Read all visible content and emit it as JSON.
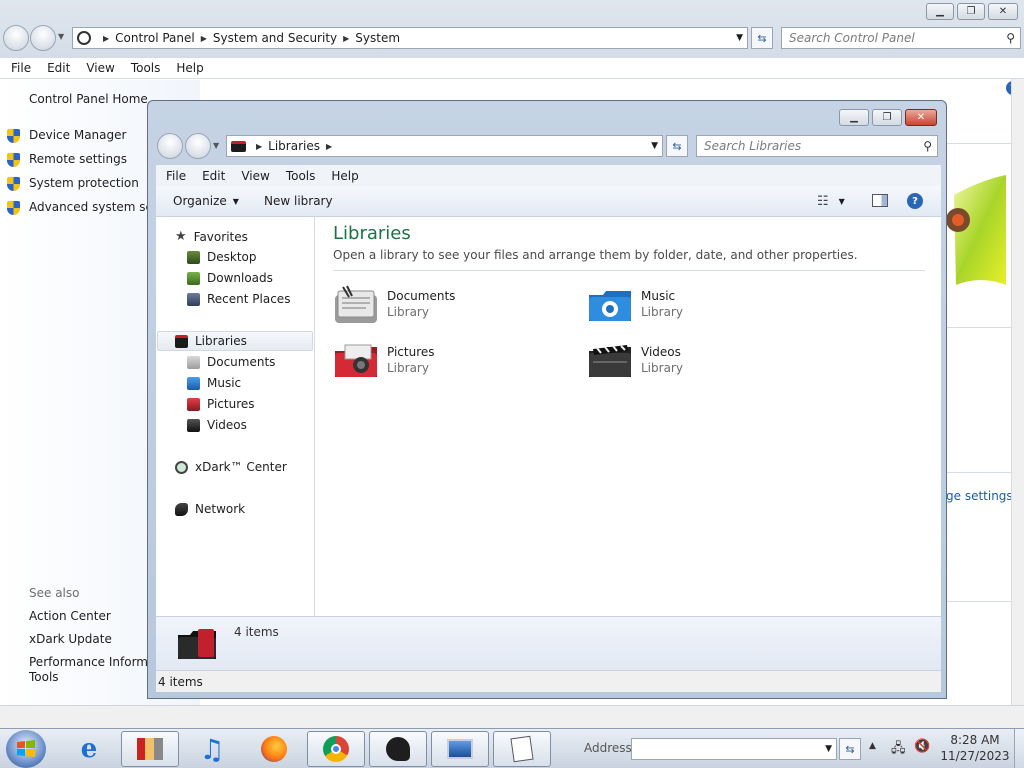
{
  "control_panel": {
    "breadcrumbs": [
      "Control Panel",
      "System and Security",
      "System"
    ],
    "search_placeholder": "Search Control Panel",
    "menu": [
      "File",
      "Edit",
      "View",
      "Tools",
      "Help"
    ],
    "home_link": "Control Panel Home",
    "tasks": [
      "Device Manager",
      "Remote settings",
      "System protection",
      "Advanced system setti"
    ],
    "see_also_heading": "See also",
    "see_also": [
      "Action Center",
      "xDark Update",
      "Performance Informat",
      "Tools"
    ],
    "partial_link": "ge settings"
  },
  "libraries_window": {
    "breadcrumb": "Libraries",
    "search_placeholder": "Search Libraries",
    "menu": [
      "File",
      "Edit",
      "View",
      "Tools",
      "Help"
    ],
    "commands": {
      "organize": "Organize",
      "new_library": "New library"
    },
    "nav": {
      "favorites": {
        "label": "Favorites",
        "items": [
          "Desktop",
          "Downloads",
          "Recent Places"
        ]
      },
      "libraries": {
        "label": "Libraries",
        "items": [
          "Documents",
          "Music",
          "Pictures",
          "Videos"
        ]
      },
      "xdark": "xDark™ Center",
      "network": "Network"
    },
    "content": {
      "title": "Libraries",
      "description": "Open a library to see your files and arrange them by folder, date, and other properties.",
      "tiles": [
        {
          "name": "Documents",
          "type": "Library",
          "icon": "documents-library-icon"
        },
        {
          "name": "Music",
          "type": "Library",
          "icon": "music-library-icon"
        },
        {
          "name": "Pictures",
          "type": "Library",
          "icon": "pictures-library-icon"
        },
        {
          "name": "Videos",
          "type": "Library",
          "icon": "videos-library-icon"
        }
      ]
    },
    "details_count": "4 items",
    "status": "4 items"
  },
  "taskbar": {
    "address_label": "Address",
    "time": "8:28 AM",
    "date": "11/27/2023"
  },
  "colors": {
    "title_green": "#1e7145",
    "link_blue": "#1e5aa8"
  }
}
